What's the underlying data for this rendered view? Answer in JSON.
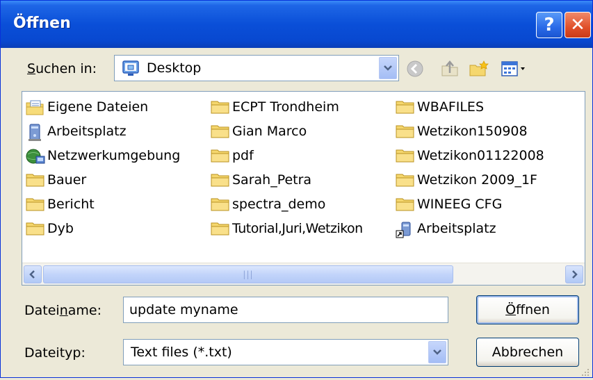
{
  "window": {
    "title": "Öffnen",
    "help_label": "?",
    "close_label": "✕"
  },
  "lookin": {
    "label_pre": "",
    "label_accel": "S",
    "label_post": "uchen in:",
    "value": "Desktop"
  },
  "toolbar": {
    "icons": [
      "back-icon",
      "up-folder-icon",
      "new-folder-icon",
      "view-menu-icon"
    ]
  },
  "files": {
    "col1": [
      {
        "name": "Eigene Dateien",
        "icon": "my-documents-icon"
      },
      {
        "name": "Arbeitsplatz",
        "icon": "my-computer-icon"
      },
      {
        "name": "Netzwerkumgebung",
        "icon": "network-icon"
      },
      {
        "name": "Bauer",
        "icon": "folder-icon"
      },
      {
        "name": "Bericht",
        "icon": "folder-icon"
      },
      {
        "name": "Dyb",
        "icon": "folder-icon"
      }
    ],
    "col2": [
      {
        "name": "ECPT Trondheim",
        "icon": "folder-icon"
      },
      {
        "name": "Gian Marco",
        "icon": "folder-icon"
      },
      {
        "name": "pdf",
        "icon": "folder-icon"
      },
      {
        "name": "Sarah_Petra",
        "icon": "folder-icon"
      },
      {
        "name": "spectra_demo",
        "icon": "folder-icon"
      },
      {
        "name": "Tutorial,Juri,Wetzikon",
        "icon": "folder-icon"
      }
    ],
    "col3": [
      {
        "name": "WBAFILES",
        "icon": "folder-icon"
      },
      {
        "name": "Wetzikon150908",
        "icon": "folder-icon"
      },
      {
        "name": "Wetzikon01122008",
        "icon": "folder-icon"
      },
      {
        "name": "Wetzikon 2009_1F",
        "icon": "folder-icon"
      },
      {
        "name": "WINEEG CFG",
        "icon": "folder-icon"
      },
      {
        "name": "Arbeitsplatz",
        "icon": "shortcut-icon"
      }
    ]
  },
  "filename": {
    "label_pre": "Datei",
    "label_accel": "n",
    "label_post": "ame:",
    "value": "update myname"
  },
  "filetype": {
    "label": "Dateityp:",
    "value": "Text files (*.txt)"
  },
  "buttons": {
    "open_accel": "Ö",
    "open_rest": "ffnen",
    "cancel": "Abbrechen"
  },
  "colors": {
    "titlebar": "#0A4FD8",
    "dialog_bg": "#ECE9D8",
    "folder_yellow": "#F5D76E",
    "border": "#7F9DB9"
  }
}
